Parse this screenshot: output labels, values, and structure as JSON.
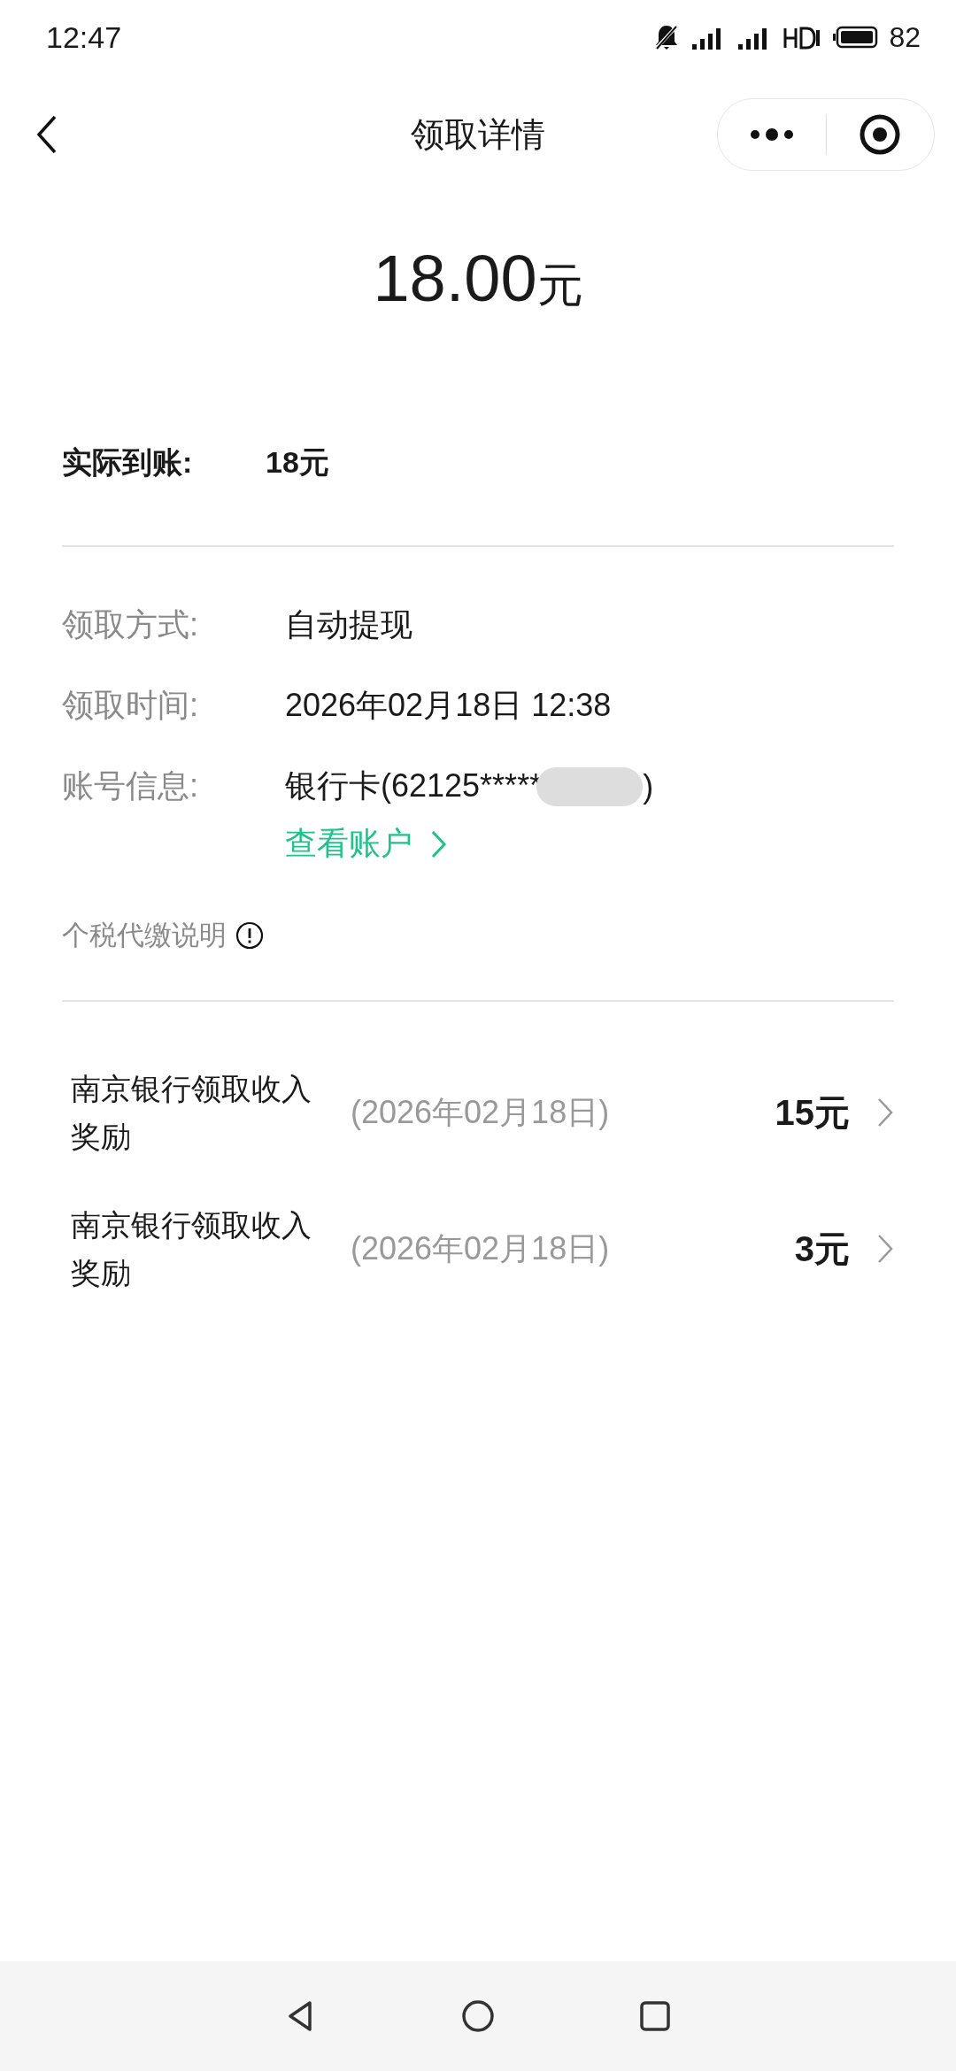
{
  "status_bar": {
    "time": "12:47",
    "battery": "82"
  },
  "nav": {
    "title": "领取详情"
  },
  "amount": {
    "number": "18.00",
    "unit": "元"
  },
  "actual": {
    "label": "实际到账:",
    "value": "18元"
  },
  "details": [
    {
      "label": "领取方式:",
      "value": "自动提现"
    },
    {
      "label": "领取时间:",
      "value": "2026年02月18日 12:38"
    },
    {
      "label": "账号信息:",
      "value": "银行卡(62125*****",
      "value_end": ")",
      "link": "查看账户"
    }
  ],
  "tax_note": "个税代缴说明",
  "records": [
    {
      "title": "南京银行领取收入奖励",
      "date": "(2026年02月18日)",
      "amount": "15元"
    },
    {
      "title": "南京银行领取收入奖励",
      "date": "(2026年02月18日)",
      "amount": "3元"
    }
  ]
}
